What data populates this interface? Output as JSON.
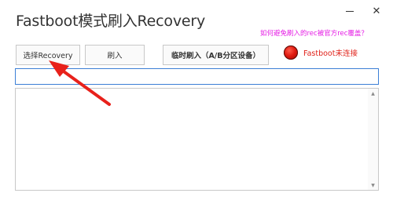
{
  "window": {
    "title": "Fastboot模式刷入Recovery",
    "minimize_glyph": "",
    "close_glyph": "✕"
  },
  "help_link": "如何避免刷入的rec被官方rec覆盖？",
  "toolbar": {
    "select_label": "选择Recovery",
    "flash_label": "刷入",
    "temp_flash_label": "临时刷入（A/B分区设备）"
  },
  "status": {
    "text": "Fastboot未连接",
    "led_color": "#e01a10",
    "icon": "red-led-icon"
  },
  "path_input": {
    "value": "",
    "placeholder": ""
  },
  "log": {
    "text": ""
  },
  "annotation": {
    "icon": "red-arrow-icon",
    "color": "#e8211b"
  },
  "colors": {
    "accent_border": "#3c7fd6",
    "link": "#e51be5",
    "status_text": "#e0221a"
  }
}
